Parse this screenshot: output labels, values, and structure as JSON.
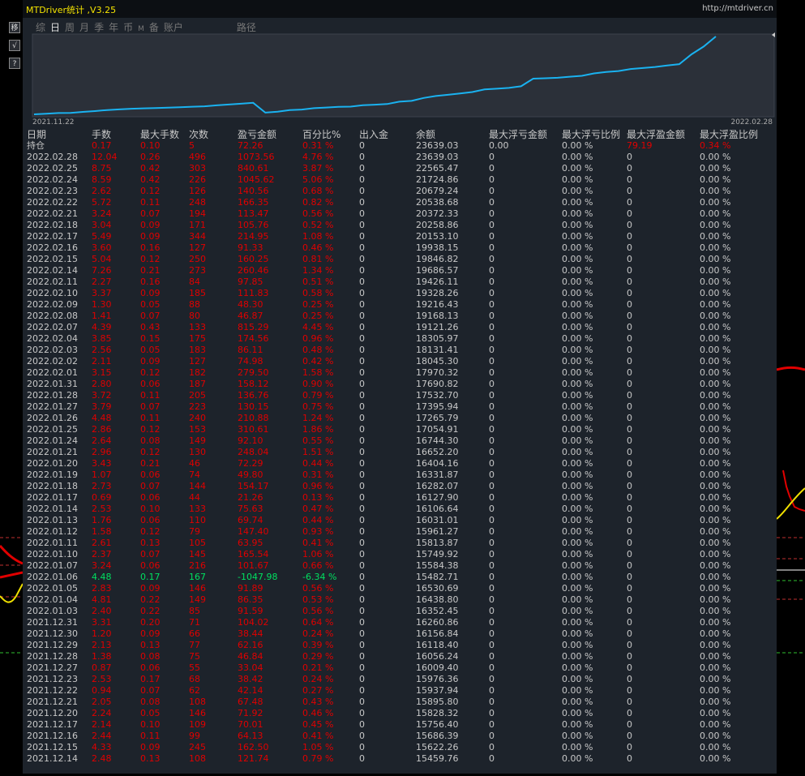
{
  "app_title": "MTDriver统计 ,V3.25",
  "site_link": "http://mtdriver.cn",
  "side_buttons": [
    "移",
    "√",
    "?"
  ],
  "tabs": [
    {
      "label": "综",
      "active": false
    },
    {
      "label": "日",
      "active": true
    },
    {
      "label": "周",
      "active": false
    },
    {
      "label": "月",
      "active": false
    },
    {
      "label": "季",
      "active": false
    },
    {
      "label": "年",
      "active": false
    },
    {
      "label": "币",
      "active": false
    },
    {
      "label": "M",
      "active": false,
      "small": true
    },
    {
      "label": "备",
      "active": false
    },
    {
      "label": "账户",
      "active": false
    },
    {
      "label": "路径",
      "active": false
    }
  ],
  "chart_data": {
    "type": "line",
    "x_start_label": "2021.11.22",
    "x_end_label": "2022.02.28",
    "line_color": "#1ab2f0",
    "series": [
      {
        "values": [
          15300,
          15360,
          15440,
          15460,
          15560,
          15650,
          15760,
          15830,
          15900,
          15940,
          15980,
          16010,
          16060,
          16120,
          16160,
          16260,
          16350,
          16440,
          16530,
          15483,
          15584,
          15750,
          15814,
          15961,
          16031,
          16106,
          16128,
          16282,
          16332,
          16404,
          16652,
          16744,
          17055,
          17266,
          17396,
          17533,
          17691,
          17970,
          18045,
          18131,
          18306,
          19121,
          19168,
          19216,
          19328,
          19426,
          19687,
          19847,
          19938,
          20153,
          20259,
          20372,
          20539,
          20679,
          21725,
          22565,
          23639
        ]
      }
    ]
  },
  "table": {
    "headers": [
      "日期",
      "手数",
      "最大手数",
      "次数",
      "盈亏金额",
      "百分比%",
      "出入金",
      "余额",
      "最大浮亏金额",
      "最大浮亏比例",
      "最大浮盈金额",
      "最大浮盈比例"
    ],
    "rows": [
      [
        "持仓",
        "0.17",
        "0.10",
        "5",
        "72.26",
        "0.31 %",
        "0",
        "23639.03",
        "0.00",
        "0.00 %",
        "79.19",
        "0.34 %"
      ],
      [
        "2022.02.28",
        "12.04",
        "0.26",
        "496",
        "1073.56",
        "4.76 %",
        "0",
        "23639.03",
        "0",
        "0.00 %",
        "0",
        "0.00 %"
      ],
      [
        "2022.02.25",
        "8.75",
        "0.42",
        "303",
        "840.61",
        "3.87 %",
        "0",
        "22565.47",
        "0",
        "0.00 %",
        "0",
        "0.00 %"
      ],
      [
        "2022.02.24",
        "8.59",
        "0.42",
        "226",
        "1045.62",
        "5.06 %",
        "0",
        "21724.86",
        "0",
        "0.00 %",
        "0",
        "0.00 %"
      ],
      [
        "2022.02.23",
        "2.62",
        "0.12",
        "126",
        "140.56",
        "0.68 %",
        "0",
        "20679.24",
        "0",
        "0.00 %",
        "0",
        "0.00 %"
      ],
      [
        "2022.02.22",
        "5.72",
        "0.11",
        "248",
        "166.35",
        "0.82 %",
        "0",
        "20538.68",
        "0",
        "0.00 %",
        "0",
        "0.00 %"
      ],
      [
        "2022.02.21",
        "3.24",
        "0.07",
        "194",
        "113.47",
        "0.56 %",
        "0",
        "20372.33",
        "0",
        "0.00 %",
        "0",
        "0.00 %"
      ],
      [
        "2022.02.18",
        "3.04",
        "0.09",
        "171",
        "105.76",
        "0.52 %",
        "0",
        "20258.86",
        "0",
        "0.00 %",
        "0",
        "0.00 %"
      ],
      [
        "2022.02.17",
        "5.49",
        "0.09",
        "344",
        "214.95",
        "1.08 %",
        "0",
        "20153.10",
        "0",
        "0.00 %",
        "0",
        "0.00 %"
      ],
      [
        "2022.02.16",
        "3.60",
        "0.16",
        "127",
        "91.33",
        "0.46 %",
        "0",
        "19938.15",
        "0",
        "0.00 %",
        "0",
        "0.00 %"
      ],
      [
        "2022.02.15",
        "5.04",
        "0.12",
        "250",
        "160.25",
        "0.81 %",
        "0",
        "19846.82",
        "0",
        "0.00 %",
        "0",
        "0.00 %"
      ],
      [
        "2022.02.14",
        "7.26",
        "0.21",
        "273",
        "260.46",
        "1.34 %",
        "0",
        "19686.57",
        "0",
        "0.00 %",
        "0",
        "0.00 %"
      ],
      [
        "2022.02.11",
        "2.27",
        "0.16",
        "84",
        "97.85",
        "0.51 %",
        "0",
        "19426.11",
        "0",
        "0.00 %",
        "0",
        "0.00 %"
      ],
      [
        "2022.02.10",
        "3.37",
        "0.09",
        "185",
        "111.83",
        "0.58 %",
        "0",
        "19328.26",
        "0",
        "0.00 %",
        "0",
        "0.00 %"
      ],
      [
        "2022.02.09",
        "1.30",
        "0.05",
        "88",
        "48.30",
        "0.25 %",
        "0",
        "19216.43",
        "0",
        "0.00 %",
        "0",
        "0.00 %"
      ],
      [
        "2022.02.08",
        "1.41",
        "0.07",
        "80",
        "46.87",
        "0.25 %",
        "0",
        "19168.13",
        "0",
        "0.00 %",
        "0",
        "0.00 %"
      ],
      [
        "2022.02.07",
        "4.39",
        "0.43",
        "133",
        "815.29",
        "4.45 %",
        "0",
        "19121.26",
        "0",
        "0.00 %",
        "0",
        "0.00 %"
      ],
      [
        "2022.02.04",
        "3.85",
        "0.15",
        "175",
        "174.56",
        "0.96 %",
        "0",
        "18305.97",
        "0",
        "0.00 %",
        "0",
        "0.00 %"
      ],
      [
        "2022.02.03",
        "2.56",
        "0.05",
        "183",
        "86.11",
        "0.48 %",
        "0",
        "18131.41",
        "0",
        "0.00 %",
        "0",
        "0.00 %"
      ],
      [
        "2022.02.02",
        "2.11",
        "0.09",
        "127",
        "74.98",
        "0.42 %",
        "0",
        "18045.30",
        "0",
        "0.00 %",
        "0",
        "0.00 %"
      ],
      [
        "2022.02.01",
        "3.15",
        "0.12",
        "182",
        "279.50",
        "1.58 %",
        "0",
        "17970.32",
        "0",
        "0.00 %",
        "0",
        "0.00 %"
      ],
      [
        "2022.01.31",
        "2.80",
        "0.06",
        "187",
        "158.12",
        "0.90 %",
        "0",
        "17690.82",
        "0",
        "0.00 %",
        "0",
        "0.00 %"
      ],
      [
        "2022.01.28",
        "3.72",
        "0.11",
        "205",
        "136.76",
        "0.79 %",
        "0",
        "17532.70",
        "0",
        "0.00 %",
        "0",
        "0.00 %"
      ],
      [
        "2022.01.27",
        "3.79",
        "0.07",
        "223",
        "130.15",
        "0.75 %",
        "0",
        "17395.94",
        "0",
        "0.00 %",
        "0",
        "0.00 %"
      ],
      [
        "2022.01.26",
        "4.48",
        "0.11",
        "240",
        "210.88",
        "1.24 %",
        "0",
        "17265.79",
        "0",
        "0.00 %",
        "0",
        "0.00 %"
      ],
      [
        "2022.01.25",
        "2.86",
        "0.12",
        "153",
        "310.61",
        "1.86 %",
        "0",
        "17054.91",
        "0",
        "0.00 %",
        "0",
        "0.00 %"
      ],
      [
        "2022.01.24",
        "2.64",
        "0.08",
        "149",
        "92.10",
        "0.55 %",
        "0",
        "16744.30",
        "0",
        "0.00 %",
        "0",
        "0.00 %"
      ],
      [
        "2022.01.21",
        "2.96",
        "0.12",
        "130",
        "248.04",
        "1.51 %",
        "0",
        "16652.20",
        "0",
        "0.00 %",
        "0",
        "0.00 %"
      ],
      [
        "2022.01.20",
        "3.43",
        "0.21",
        "46",
        "72.29",
        "0.44 %",
        "0",
        "16404.16",
        "0",
        "0.00 %",
        "0",
        "0.00 %"
      ],
      [
        "2022.01.19",
        "1.07",
        "0.06",
        "74",
        "49.80",
        "0.31 %",
        "0",
        "16331.87",
        "0",
        "0.00 %",
        "0",
        "0.00 %"
      ],
      [
        "2022.01.18",
        "2.73",
        "0.07",
        "144",
        "154.17",
        "0.96 %",
        "0",
        "16282.07",
        "0",
        "0.00 %",
        "0",
        "0.00 %"
      ],
      [
        "2022.01.17",
        "0.69",
        "0.06",
        "44",
        "21.26",
        "0.13 %",
        "0",
        "16127.90",
        "0",
        "0.00 %",
        "0",
        "0.00 %"
      ],
      [
        "2022.01.14",
        "2.53",
        "0.10",
        "133",
        "75.63",
        "0.47 %",
        "0",
        "16106.64",
        "0",
        "0.00 %",
        "0",
        "0.00 %"
      ],
      [
        "2022.01.13",
        "1.76",
        "0.06",
        "110",
        "69.74",
        "0.44 %",
        "0",
        "16031.01",
        "0",
        "0.00 %",
        "0",
        "0.00 %"
      ],
      [
        "2022.01.12",
        "1.58",
        "0.12",
        "79",
        "147.40",
        "0.93 %",
        "0",
        "15961.27",
        "0",
        "0.00 %",
        "0",
        "0.00 %"
      ],
      [
        "2022.01.11",
        "2.61",
        "0.13",
        "105",
        "63.95",
        "0.41 %",
        "0",
        "15813.87",
        "0",
        "0.00 %",
        "0",
        "0.00 %"
      ],
      [
        "2022.01.10",
        "2.37",
        "0.07",
        "145",
        "165.54",
        "1.06 %",
        "0",
        "15749.92",
        "0",
        "0.00 %",
        "0",
        "0.00 %"
      ],
      [
        "2022.01.07",
        "3.24",
        "0.06",
        "216",
        "101.67",
        "0.66 %",
        "0",
        "15584.38",
        "0",
        "0.00 %",
        "0",
        "0.00 %"
      ],
      [
        "2022.01.06",
        "4.48",
        "0.17",
        "167",
        "-1047.98",
        "-6.34 %",
        "0",
        "15482.71",
        "0",
        "0.00 %",
        "0",
        "0.00 %"
      ],
      [
        "2022.01.05",
        "2.83",
        "0.09",
        "146",
        "91.89",
        "0.56 %",
        "0",
        "16530.69",
        "0",
        "0.00 %",
        "0",
        "0.00 %"
      ],
      [
        "2022.01.04",
        "4.81",
        "0.22",
        "149",
        "86.35",
        "0.53 %",
        "0",
        "16438.80",
        "0",
        "0.00 %",
        "0",
        "0.00 %"
      ],
      [
        "2022.01.03",
        "2.40",
        "0.22",
        "85",
        "91.59",
        "0.56 %",
        "0",
        "16352.45",
        "0",
        "0.00 %",
        "0",
        "0.00 %"
      ],
      [
        "2021.12.31",
        "3.31",
        "0.20",
        "71",
        "104.02",
        "0.64 %",
        "0",
        "16260.86",
        "0",
        "0.00 %",
        "0",
        "0.00 %"
      ],
      [
        "2021.12.30",
        "1.20",
        "0.09",
        "66",
        "38.44",
        "0.24 %",
        "0",
        "16156.84",
        "0",
        "0.00 %",
        "0",
        "0.00 %"
      ],
      [
        "2021.12.29",
        "2.13",
        "0.13",
        "77",
        "62.16",
        "0.39 %",
        "0",
        "16118.40",
        "0",
        "0.00 %",
        "0",
        "0.00 %"
      ],
      [
        "2021.12.28",
        "1.38",
        "0.08",
        "75",
        "46.84",
        "0.29 %",
        "0",
        "16056.24",
        "0",
        "0.00 %",
        "0",
        "0.00 %"
      ],
      [
        "2021.12.27",
        "0.87",
        "0.06",
        "55",
        "33.04",
        "0.21 %",
        "0",
        "16009.40",
        "0",
        "0.00 %",
        "0",
        "0.00 %"
      ],
      [
        "2021.12.23",
        "2.53",
        "0.17",
        "68",
        "38.42",
        "0.24 %",
        "0",
        "15976.36",
        "0",
        "0.00 %",
        "0",
        "0.00 %"
      ],
      [
        "2021.12.22",
        "0.94",
        "0.07",
        "62",
        "42.14",
        "0.27 %",
        "0",
        "15937.94",
        "0",
        "0.00 %",
        "0",
        "0.00 %"
      ],
      [
        "2021.12.21",
        "2.05",
        "0.08",
        "108",
        "67.48",
        "0.43 %",
        "0",
        "15895.80",
        "0",
        "0.00 %",
        "0",
        "0.00 %"
      ],
      [
        "2021.12.20",
        "2.24",
        "0.05",
        "146",
        "71.92",
        "0.46 %",
        "0",
        "15828.32",
        "0",
        "0.00 %",
        "0",
        "0.00 %"
      ],
      [
        "2021.12.17",
        "2.14",
        "0.10",
        "109",
        "70.01",
        "0.45 %",
        "0",
        "15756.40",
        "0",
        "0.00 %",
        "0",
        "0.00 %"
      ],
      [
        "2021.12.16",
        "2.44",
        "0.11",
        "99",
        "64.13",
        "0.41 %",
        "0",
        "15686.39",
        "0",
        "0.00 %",
        "0",
        "0.00 %"
      ],
      [
        "2021.12.15",
        "4.33",
        "0.09",
        "245",
        "162.50",
        "1.05 %",
        "0",
        "15622.26",
        "0",
        "0.00 %",
        "0",
        "0.00 %"
      ],
      [
        "2021.12.14",
        "2.48",
        "0.13",
        "108",
        "121.74",
        "0.79 %",
        "0",
        "15459.76",
        "0",
        "0.00 %",
        "0",
        "0.00 %"
      ]
    ]
  }
}
